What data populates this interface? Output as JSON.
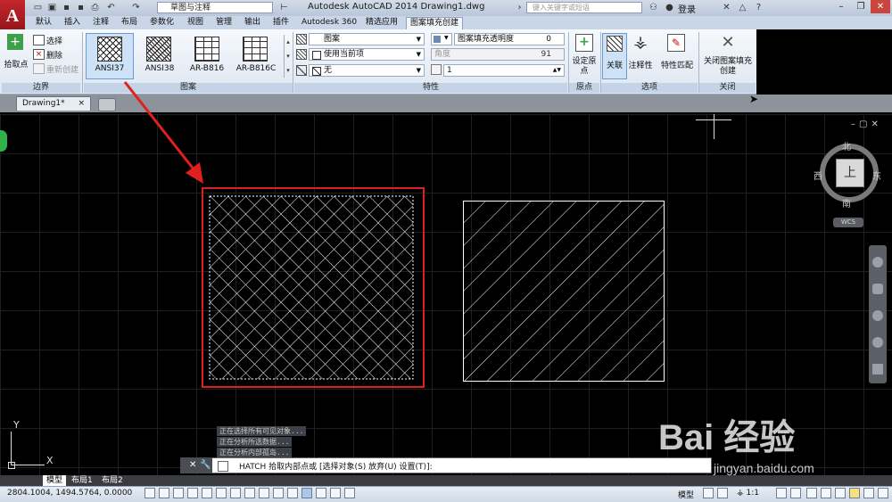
{
  "app": {
    "title": "Autodesk AutoCAD 2014    Drawing1.dwg",
    "workspace": "草图与注释",
    "search_placeholder": "键入关键字或短语",
    "login": "登录",
    "logo": "A"
  },
  "tabs": [
    "默认",
    "插入",
    "注释",
    "布局",
    "参数化",
    "视图",
    "管理",
    "输出",
    "插件",
    "Autodesk 360",
    "精选应用",
    "图案填充创建"
  ],
  "ribbon": {
    "boundary": {
      "pick_point": "拾取点",
      "select": "选择",
      "remove": "删除",
      "recreate": "重新创建",
      "title": "边界"
    },
    "pattern": {
      "title": "图案",
      "items": [
        "ANSI37",
        "ANSI38",
        "AR-B816",
        "AR-B816C"
      ]
    },
    "properties": {
      "title": "特性",
      "type": "图案",
      "color": "使用当前项",
      "bg_color": "无",
      "transparency_label": "图案填充透明度",
      "transparency_value": "0",
      "angle_label": "角度",
      "angle_value": "91",
      "scale_value": "1"
    },
    "origin": {
      "set_origin": "设定原点",
      "title": "原点"
    },
    "options": {
      "associative": "关联",
      "annotative": "注释性",
      "match": "特性匹配",
      "title": "选项"
    },
    "close": {
      "label": "关闭图案填充创建",
      "title": "关闭"
    }
  },
  "document_tab": "Drawing1*",
  "viewcube": {
    "north": "北",
    "south": "南",
    "west": "西",
    "east": "东",
    "top": "上",
    "wcs": "WCS"
  },
  "ucs": {
    "y": "Y",
    "x": "X"
  },
  "command": {
    "history": [
      "正在选择所有可见对象...",
      "正在分析所选数据...",
      "正在分析内部孤岛..."
    ],
    "prompt": "HATCH 拾取内部点或 [选择对象(S) 放弃(U) 设置(T)]:"
  },
  "layout_tabs": [
    "模型",
    "布局1",
    "布局2"
  ],
  "status": {
    "coords": "2804.1004, 1494.5764, 0.0000",
    "model": "模型",
    "scale": "1:1"
  },
  "watermark": {
    "logo": "Bai 经验",
    "url": "jingyan.baidu.com"
  },
  "colors": {
    "highlight": "#e02020",
    "ribbon_bg": "#dde6f1",
    "canvas_bg": "#000000"
  }
}
